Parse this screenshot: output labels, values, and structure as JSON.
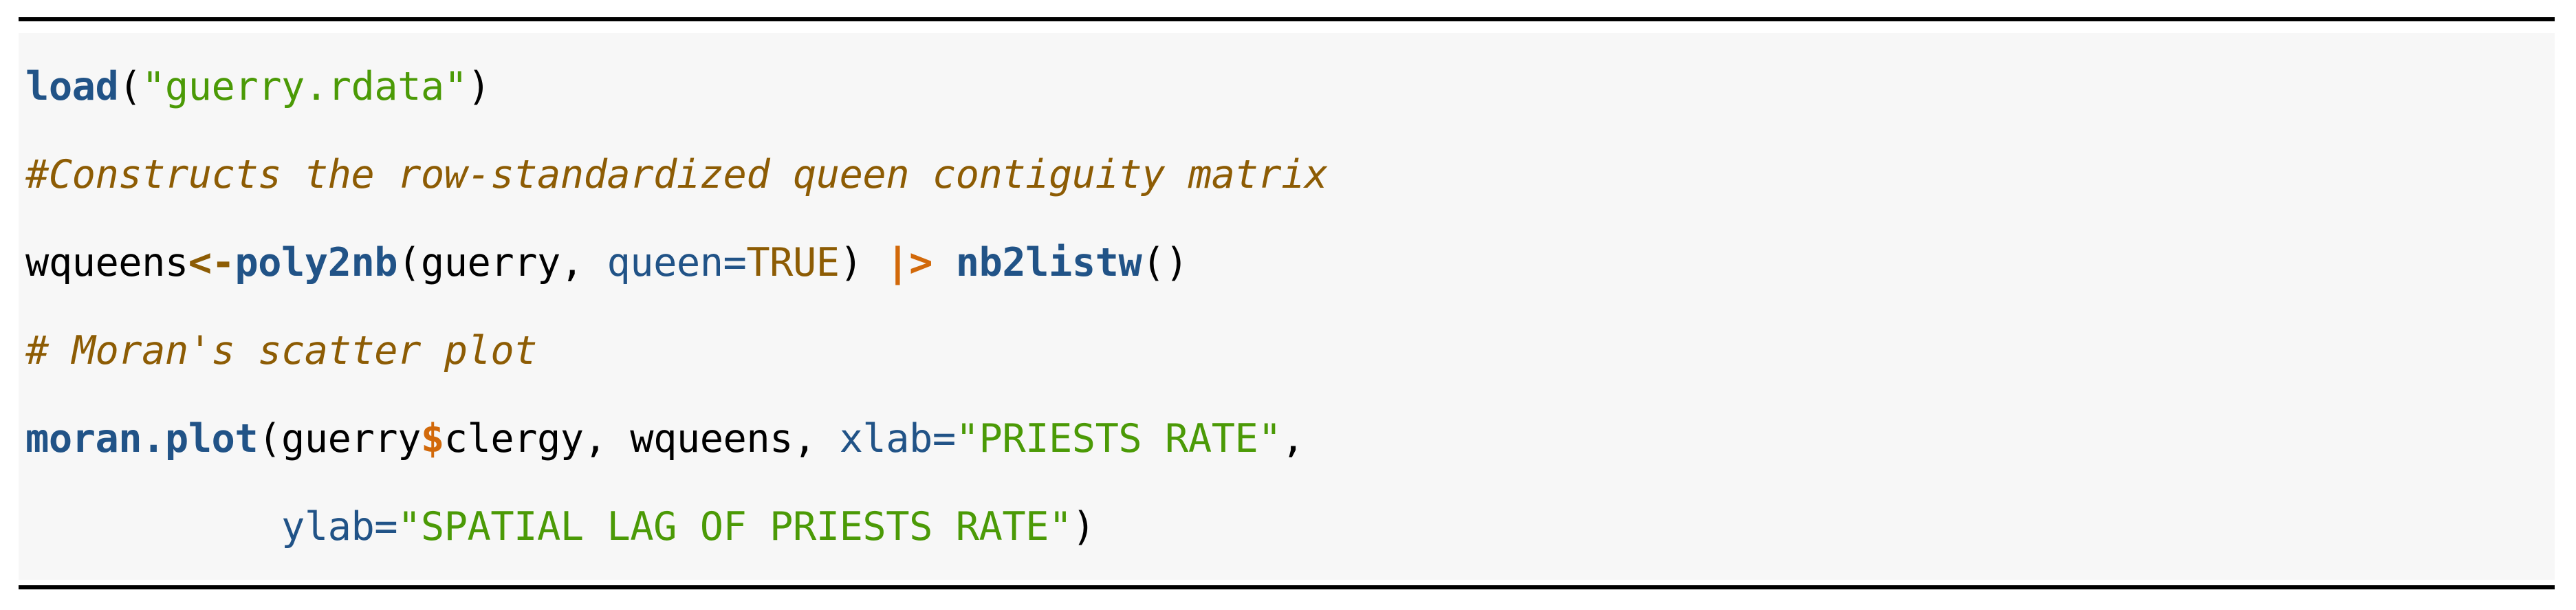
{
  "figure": {
    "kind": "r-code-listing",
    "background_color": "#f7f7f7",
    "page_background_color": "#ffffff",
    "rule_color": "#000000",
    "language": "R"
  },
  "palette": {
    "plain": "#000000",
    "function": "#215387",
    "string": "#4b9a06",
    "comment": "#8d5c04",
    "argument": "#215387",
    "constant": "#8d5c04",
    "assign_arrow": "#8d5c04",
    "pipe_operator": "#d2690a",
    "dollar_operator": "#d2690a"
  },
  "code": {
    "lines": [
      {
        "id": "line-1",
        "text": "load(\"guerry.rdata\")",
        "tokens": [
          {
            "t": "load",
            "k": "func"
          },
          {
            "t": "(",
            "k": "plain"
          },
          {
            "t": "\"guerry.rdata\"",
            "k": "string"
          },
          {
            "t": ")",
            "k": "plain"
          }
        ]
      },
      {
        "id": "line-2",
        "text": "#Constructs the row-standardized queen contiguity matrix",
        "tokens": [
          {
            "t": "#Constructs the row-standardized queen contiguity matrix",
            "k": "comment"
          }
        ]
      },
      {
        "id": "line-3",
        "text": "wqueens<-poly2nb(guerry, queen=TRUE) |> nb2listw()",
        "tokens": [
          {
            "t": "wqueens",
            "k": "plain"
          },
          {
            "t": "<-",
            "k": "assign"
          },
          {
            "t": "poly2nb",
            "k": "func"
          },
          {
            "t": "(guerry, ",
            "k": "plain"
          },
          {
            "t": "queen=",
            "k": "arg"
          },
          {
            "t": "TRUE",
            "k": "const"
          },
          {
            "t": ") ",
            "k": "plain"
          },
          {
            "t": "|>",
            "k": "pipe"
          },
          {
            "t": " ",
            "k": "plain"
          },
          {
            "t": "nb2listw",
            "k": "func"
          },
          {
            "t": "()",
            "k": "plain"
          }
        ]
      },
      {
        "id": "line-4",
        "text": "# Moran's scatter plot",
        "tokens": [
          {
            "t": "# Moran's scatter plot",
            "k": "comment"
          }
        ]
      },
      {
        "id": "line-5",
        "text": "moran.plot(guerry$clergy, wqueens, xlab=\"PRIESTS RATE\",",
        "tokens": [
          {
            "t": "moran.plot",
            "k": "func"
          },
          {
            "t": "(guerry",
            "k": "plain"
          },
          {
            "t": "$",
            "k": "dollar"
          },
          {
            "t": "clergy, wqueens, ",
            "k": "plain"
          },
          {
            "t": "xlab=",
            "k": "arg"
          },
          {
            "t": "\"PRIESTS RATE\"",
            "k": "string"
          },
          {
            "t": ",",
            "k": "plain"
          }
        ]
      },
      {
        "id": "line-6",
        "text": "           ylab=\"SPATIAL LAG OF PRIESTS RATE\")",
        "tokens": [
          {
            "t": "           ",
            "k": "plain"
          },
          {
            "t": "ylab=",
            "k": "arg"
          },
          {
            "t": "\"SPATIAL LAG OF PRIESTS RATE\"",
            "k": "string"
          },
          {
            "t": ")",
            "k": "plain"
          }
        ]
      }
    ]
  }
}
